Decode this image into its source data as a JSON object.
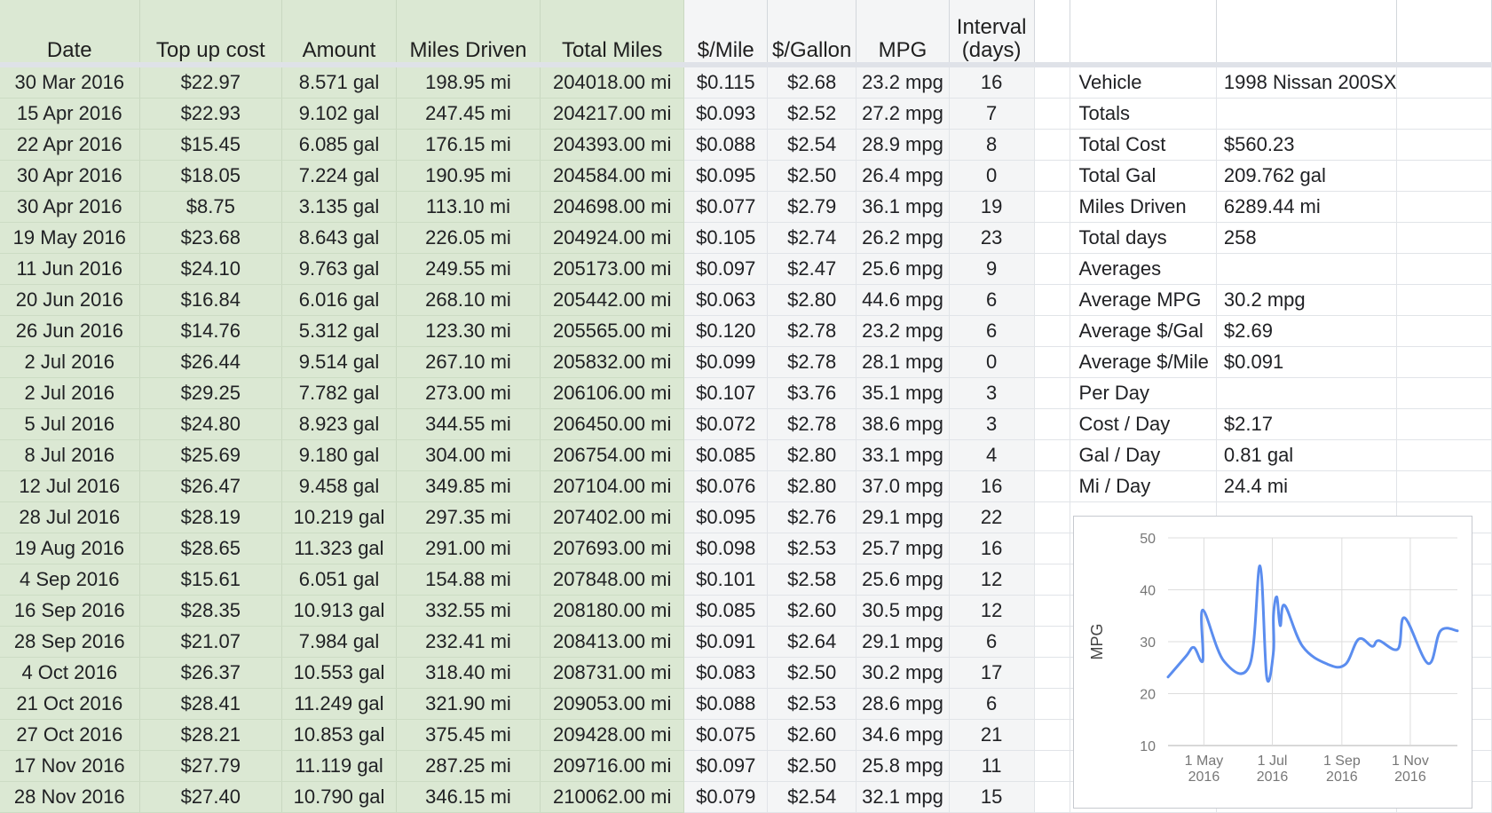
{
  "headers": {
    "date": "Date",
    "top_up_cost": "Top up cost",
    "amount": "Amount",
    "miles_driven": "Miles Driven",
    "total_miles": "Total Miles",
    "per_mile": "$/Mile",
    "per_gallon": "$/Gallon",
    "mpg": "MPG",
    "interval_1": "Interval",
    "interval_2": "(days)"
  },
  "rows": [
    [
      "30 Mar 2016",
      "$22.97",
      "8.571 gal",
      "198.95 mi",
      "204018.00 mi",
      "$0.115",
      "$2.68",
      "23.2 mpg",
      "16"
    ],
    [
      "15 Apr 2016",
      "$22.93",
      "9.102 gal",
      "247.45 mi",
      "204217.00 mi",
      "$0.093",
      "$2.52",
      "27.2 mpg",
      "7"
    ],
    [
      "22 Apr 2016",
      "$15.45",
      "6.085 gal",
      "176.15 mi",
      "204393.00 mi",
      "$0.088",
      "$2.54",
      "28.9 mpg",
      "8"
    ],
    [
      "30 Apr 2016",
      "$18.05",
      "7.224 gal",
      "190.95 mi",
      "204584.00 mi",
      "$0.095",
      "$2.50",
      "26.4 mpg",
      "0"
    ],
    [
      "30 Apr 2016",
      "$8.75",
      "3.135 gal",
      "113.10 mi",
      "204698.00 mi",
      "$0.077",
      "$2.79",
      "36.1 mpg",
      "19"
    ],
    [
      "19 May 2016",
      "$23.68",
      "8.643 gal",
      "226.05 mi",
      "204924.00 mi",
      "$0.105",
      "$2.74",
      "26.2 mpg",
      "23"
    ],
    [
      "11 Jun 2016",
      "$24.10",
      "9.763 gal",
      "249.55 mi",
      "205173.00 mi",
      "$0.097",
      "$2.47",
      "25.6 mpg",
      "9"
    ],
    [
      "20 Jun 2016",
      "$16.84",
      "6.016 gal",
      "268.10 mi",
      "205442.00 mi",
      "$0.063",
      "$2.80",
      "44.6 mpg",
      "6"
    ],
    [
      "26 Jun 2016",
      "$14.76",
      "5.312 gal",
      "123.30 mi",
      "205565.00 mi",
      "$0.120",
      "$2.78",
      "23.2 mpg",
      "6"
    ],
    [
      "2 Jul 2016",
      "$26.44",
      "9.514 gal",
      "267.10 mi",
      "205832.00 mi",
      "$0.099",
      "$2.78",
      "28.1 mpg",
      "0"
    ],
    [
      "2 Jul 2016",
      "$29.25",
      "7.782 gal",
      "273.00 mi",
      "206106.00 mi",
      "$0.107",
      "$3.76",
      "35.1 mpg",
      "3"
    ],
    [
      "5 Jul 2016",
      "$24.80",
      "8.923 gal",
      "344.55 mi",
      "206450.00 mi",
      "$0.072",
      "$2.78",
      "38.6 mpg",
      "3"
    ],
    [
      "8 Jul 2016",
      "$25.69",
      "9.180 gal",
      "304.00 mi",
      "206754.00 mi",
      "$0.085",
      "$2.80",
      "33.1 mpg",
      "4"
    ],
    [
      "12 Jul 2016",
      "$26.47",
      "9.458 gal",
      "349.85 mi",
      "207104.00 mi",
      "$0.076",
      "$2.80",
      "37.0 mpg",
      "16"
    ],
    [
      "28 Jul 2016",
      "$28.19",
      "10.219 gal",
      "297.35 mi",
      "207402.00 mi",
      "$0.095",
      "$2.76",
      "29.1 mpg",
      "22"
    ],
    [
      "19 Aug 2016",
      "$28.65",
      "11.323 gal",
      "291.00 mi",
      "207693.00 mi",
      "$0.098",
      "$2.53",
      "25.7 mpg",
      "16"
    ],
    [
      "4 Sep 2016",
      "$15.61",
      "6.051 gal",
      "154.88 mi",
      "207848.00 mi",
      "$0.101",
      "$2.58",
      "25.6 mpg",
      "12"
    ],
    [
      "16 Sep 2016",
      "$28.35",
      "10.913 gal",
      "332.55 mi",
      "208180.00 mi",
      "$0.085",
      "$2.60",
      "30.5 mpg",
      "12"
    ],
    [
      "28 Sep 2016",
      "$21.07",
      "7.984 gal",
      "232.41 mi",
      "208413.00 mi",
      "$0.091",
      "$2.64",
      "29.1 mpg",
      "6"
    ],
    [
      "4 Oct 2016",
      "$26.37",
      "10.553 gal",
      "318.40 mi",
      "208731.00 mi",
      "$0.083",
      "$2.50",
      "30.2 mpg",
      "17"
    ],
    [
      "21 Oct 2016",
      "$28.41",
      "11.249 gal",
      "321.90 mi",
      "209053.00 mi",
      "$0.088",
      "$2.53",
      "28.6 mpg",
      "6"
    ],
    [
      "27 Oct 2016",
      "$28.21",
      "10.853 gal",
      "375.45 mi",
      "209428.00 mi",
      "$0.075",
      "$2.60",
      "34.6 mpg",
      "21"
    ],
    [
      "17 Nov 2016",
      "$27.79",
      "11.119 gal",
      "287.25 mi",
      "209716.00 mi",
      "$0.097",
      "$2.50",
      "25.8 mpg",
      "11"
    ],
    [
      "28 Nov 2016",
      "$27.40",
      "10.790 gal",
      "346.15 mi",
      "210062.00 mi",
      "$0.079",
      "$2.54",
      "32.1 mpg",
      "15"
    ]
  ],
  "summary": [
    {
      "label": "Vehicle",
      "value": "1998 Nissan 200SX",
      "bold": false
    },
    {
      "label": "Totals",
      "value": "",
      "bold": true
    },
    {
      "label": "Total Cost",
      "value": "$560.23",
      "bold": false
    },
    {
      "label": "Total Gal",
      "value": "209.762 gal",
      "bold": false
    },
    {
      "label": "Miles Driven",
      "value": "6289.44 mi",
      "bold": false
    },
    {
      "label": "Total days",
      "value": "258",
      "bold": false
    },
    {
      "label": "Averages",
      "value": "",
      "bold": true
    },
    {
      "label": "Average MPG",
      "value": "30.2 mpg",
      "bold": false
    },
    {
      "label": "Average $/Gal",
      "value": "$2.69",
      "bold": false
    },
    {
      "label": "Average $/Mile",
      "value": "$0.091",
      "bold": false
    },
    {
      "label": "Per Day",
      "value": "",
      "bold": true
    },
    {
      "label": "Cost / Day",
      "value": "$2.17",
      "bold": false
    },
    {
      "label": "Gal / Day",
      "value": "0.81 gal",
      "bold": false
    },
    {
      "label": "Mi / Day",
      "value": "24.4 mi",
      "bold": false
    }
  ],
  "chart_data": {
    "type": "line",
    "title": "",
    "xlabel": "",
    "ylabel": "MPG",
    "ylim": [
      10,
      50
    ],
    "yticks": [
      10,
      20,
      30,
      40,
      50
    ],
    "xticks": [
      {
        "date": "2016-05-01",
        "line1": "1 May",
        "line2": "2016"
      },
      {
        "date": "2016-07-01",
        "line1": "1 Jul",
        "line2": "2016"
      },
      {
        "date": "2016-09-01",
        "line1": "1 Sep",
        "line2": "2016"
      },
      {
        "date": "2016-11-01",
        "line1": "1 Nov",
        "line2": "2016"
      }
    ],
    "xlim": [
      "2016-03-30",
      "2016-12-13"
    ],
    "grid": true,
    "line_color": "#5b8def",
    "series": [
      {
        "x": [
          "2016-03-30",
          "2016-04-15",
          "2016-04-22",
          "2016-04-30",
          "2016-04-30",
          "2016-05-19",
          "2016-06-11",
          "2016-06-20",
          "2016-06-26",
          "2016-07-02",
          "2016-07-02",
          "2016-07-05",
          "2016-07-08",
          "2016-07-12",
          "2016-07-28",
          "2016-08-19",
          "2016-09-04",
          "2016-09-16",
          "2016-09-28",
          "2016-10-04",
          "2016-10-21",
          "2016-10-27",
          "2016-11-17",
          "2016-11-28",
          "2016-12-13"
        ],
        "y": [
          23.2,
          27.2,
          28.9,
          26.4,
          36.1,
          26.2,
          25.6,
          44.6,
          23.2,
          28.1,
          35.1,
          38.6,
          33.1,
          37.0,
          29.1,
          25.7,
          25.6,
          30.5,
          29.1,
          30.2,
          28.6,
          34.6,
          25.8,
          32.1,
          32.1
        ]
      }
    ]
  }
}
